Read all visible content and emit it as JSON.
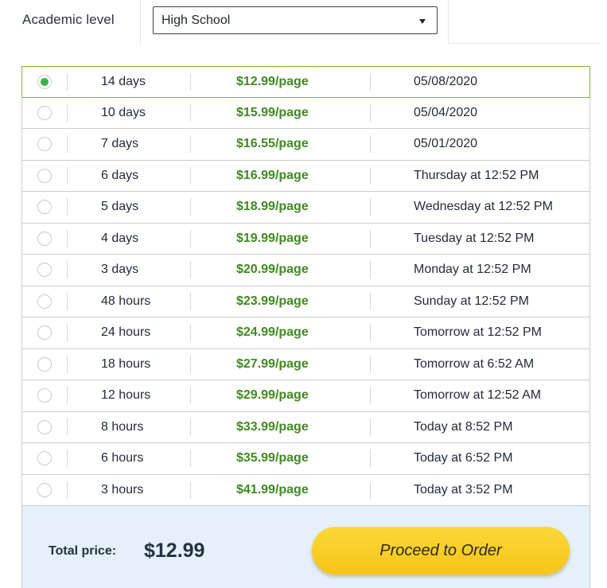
{
  "academic_level": {
    "label": "Academic level",
    "selected": "High School"
  },
  "deadlines": [
    {
      "duration": "14 days",
      "price": "$12.99/page",
      "date": "05/08/2020",
      "selected": true
    },
    {
      "duration": "10 days",
      "price": "$15.99/page",
      "date": "05/04/2020",
      "selected": false
    },
    {
      "duration": "7 days",
      "price": "$16.55/page",
      "date": "05/01/2020",
      "selected": false
    },
    {
      "duration": "6 days",
      "price": "$16.99/page",
      "date": "Thursday at 12:52 PM",
      "selected": false
    },
    {
      "duration": "5 days",
      "price": "$18.99/page",
      "date": "Wednesday at 12:52 PM",
      "selected": false
    },
    {
      "duration": "4 days",
      "price": "$19.99/page",
      "date": "Tuesday at 12:52 PM",
      "selected": false
    },
    {
      "duration": "3 days",
      "price": "$20.99/page",
      "date": "Monday at 12:52 PM",
      "selected": false
    },
    {
      "duration": "48 hours",
      "price": "$23.99/page",
      "date": "Sunday at 12:52 PM",
      "selected": false
    },
    {
      "duration": "24 hours",
      "price": "$24.99/page",
      "date": "Tomorrow at 12:52 PM",
      "selected": false
    },
    {
      "duration": "18 hours",
      "price": "$27.99/page",
      "date": "Tomorrow at 6:52 AM",
      "selected": false
    },
    {
      "duration": "12 hours",
      "price": "$29.99/page",
      "date": "Tomorrow at 12:52 AM",
      "selected": false
    },
    {
      "duration": "8 hours",
      "price": "$33.99/page",
      "date": "Today at 8:52 PM",
      "selected": false
    },
    {
      "duration": "6 hours",
      "price": "$35.99/page",
      "date": "Today at 6:52 PM",
      "selected": false
    },
    {
      "duration": "3 hours",
      "price": "$41.99/page",
      "date": "Today at 3:52 PM",
      "selected": false
    }
  ],
  "footer": {
    "total_label": "Total price:",
    "total_value": "$12.99",
    "proceed_label": "Proceed to Order"
  },
  "colors": {
    "price_green": "#3e8a1e",
    "radio_checked": "#38b449",
    "selected_border": "#7db84a",
    "footer_bg": "#e5f0fa",
    "button_yellow": "#f9cf2a"
  },
  "icons": {
    "dropdown": "chevron-down-icon",
    "radio": "radio-icon"
  }
}
